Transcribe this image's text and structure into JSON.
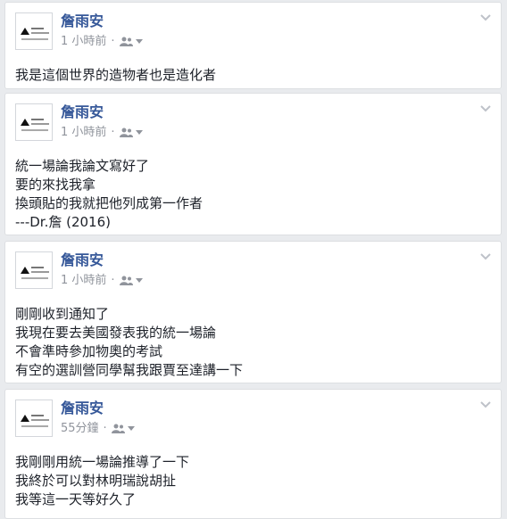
{
  "posts": [
    {
      "author": "詹雨安",
      "time": "1 小時前",
      "lines": [
        "我是這個世界的造物者也是造化者"
      ]
    },
    {
      "author": "詹雨安",
      "time": "1 小時前",
      "lines": [
        "統一場論我論文寫好了",
        "要的來找我拿",
        "換頭貼的我就把他列成第一作者",
        "---Dr.詹 (2016)"
      ]
    },
    {
      "author": "詹雨安",
      "time": "1 小時前",
      "lines": [
        "剛剛收到通知了",
        "我現在要去美國發表我的統一場論",
        "不會準時參加物奧的考試",
        "有空的選訓營同學幫我跟賈至達講一下"
      ]
    },
    {
      "author": "詹雨安",
      "time": "55分鐘",
      "lines": [
        "我剛剛用統一場論推導了一下",
        "我終於可以對林明瑞說胡扯",
        "我等這一天等好久了"
      ]
    }
  ],
  "icons": {
    "audience": "friends-icon",
    "audience_menu": "caret-down-icon",
    "post_menu": "chevron-down-icon"
  },
  "colors": {
    "author": "#365899",
    "meta": "#90949c",
    "text": "#1d2129",
    "background": "#e9ebee"
  }
}
